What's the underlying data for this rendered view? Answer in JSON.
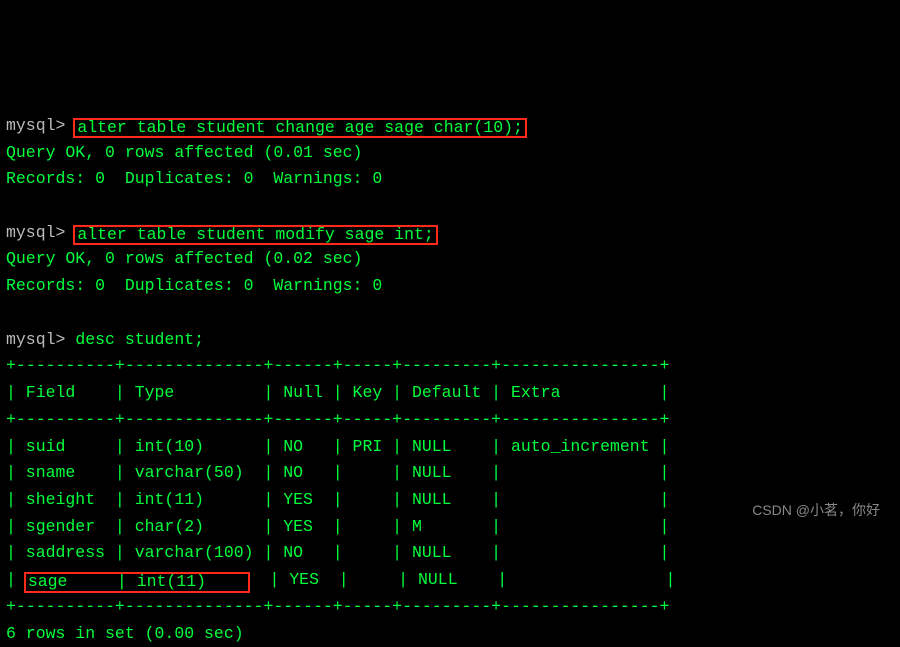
{
  "prompt": "mysql>",
  "cmd1": "alter table student change age sage char(10);",
  "out1a": "Query OK, 0 rows affected (0.01 sec)",
  "out1b": "Records: 0  Duplicates: 0  Warnings: 0",
  "cmd2": "alter table student modify sage int;",
  "out2a": "Query OK, 0 rows affected (0.02 sec)",
  "out2b": "Records: 0  Duplicates: 0  Warnings: 0",
  "cmd3": "desc student;",
  "sep": "+----------+--------------+------+-----+---------+----------------+",
  "hdr": "| Field    | Type         | Null | Key | Default | Extra          |",
  "rows": [
    "| suid     | int(10)      | NO   | PRI | NULL    | auto_increment |",
    "| sname    | varchar(50)  | NO   |     | NULL    |                |",
    "| sheight  | int(11)      | YES  |     | NULL    |                |",
    "| sgender  | char(2)      | YES  |     | M       |                |",
    "| saddress | varchar(100) | NO   |     | NULL    |                |"
  ],
  "row6_pre": "| ",
  "row6_box": "sage     | int(11)    ",
  "row6_post": "  | YES  |     | NULL    |                |",
  "final": "6 rows in set (0.00 sec)",
  "watermark": "CSDN @小茗，你好",
  "chart_data": {
    "type": "table",
    "title": "desc student;",
    "columns": [
      "Field",
      "Type",
      "Null",
      "Key",
      "Default",
      "Extra"
    ],
    "rows": [
      [
        "suid",
        "int(10)",
        "NO",
        "PRI",
        "NULL",
        "auto_increment"
      ],
      [
        "sname",
        "varchar(50)",
        "NO",
        "",
        "NULL",
        ""
      ],
      [
        "sheight",
        "int(11)",
        "YES",
        "",
        "NULL",
        ""
      ],
      [
        "sgender",
        "char(2)",
        "YES",
        "",
        "M",
        ""
      ],
      [
        "saddress",
        "varchar(100)",
        "NO",
        "",
        "NULL",
        ""
      ],
      [
        "sage",
        "int(11)",
        "YES",
        "",
        "NULL",
        ""
      ]
    ]
  }
}
